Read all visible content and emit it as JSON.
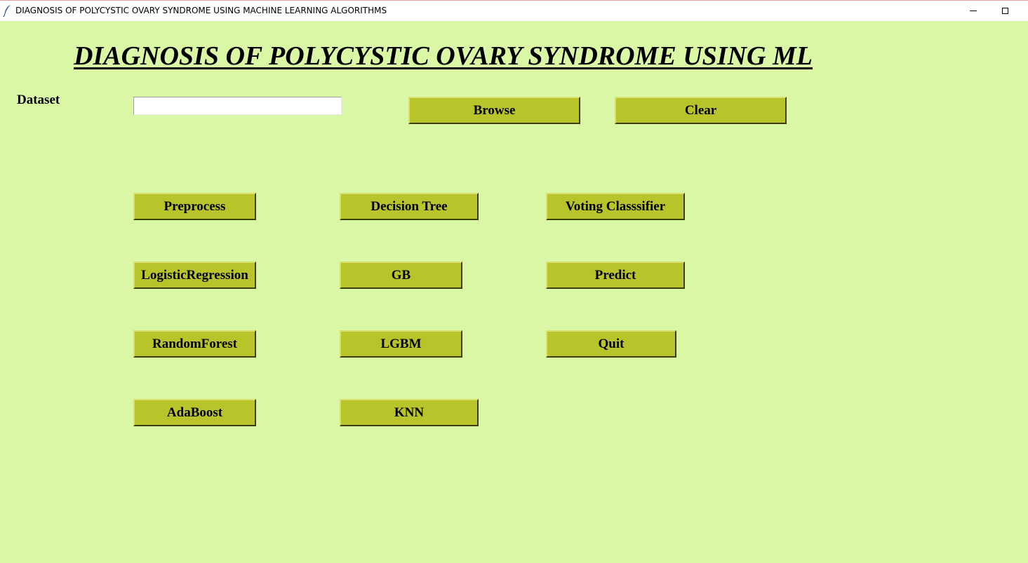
{
  "window": {
    "title": "DIAGNOSIS OF  POLYCYSTIC OVARY SYNDROME USING MACHINE LEARNING ALGORITHMS",
    "icon": "feather-icon",
    "controls": [
      "minimize-icon",
      "maximize-icon"
    ]
  },
  "main": {
    "heading": "DIAGNOSIS OF  POLYCYSTIC OVARY SYNDROME USING ML",
    "dataset_label": "Dataset",
    "dataset_value": "",
    "background_color": "#daf7a6",
    "button_color": "#b8c42a"
  },
  "buttons": {
    "browse": "Browse",
    "clear": "Clear",
    "preprocess": "Preprocess",
    "decision_tree": "Decision Tree",
    "voting_classifier": "Voting Classsifier",
    "logistic_regression": "LogisticRegression",
    "gb": "GB",
    "predict": "Predict",
    "random_forest": "RandomForest",
    "lgbm": "LGBM",
    "quit": "Quit",
    "adaboost": "AdaBoost",
    "knn": "KNN"
  }
}
